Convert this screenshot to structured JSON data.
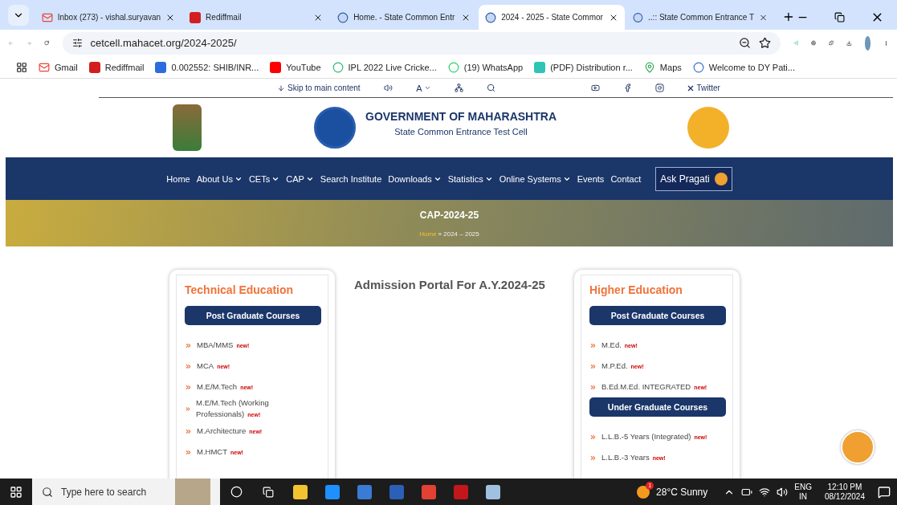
{
  "browser": {
    "tabs": [
      {
        "title": "Inbox (273) - vishal.suryavan",
        "selected": false
      },
      {
        "title": "Rediffmail",
        "selected": false
      },
      {
        "title": "Home. - State Common Entr",
        "selected": false
      },
      {
        "title": "2024 - 2025 - State Commor",
        "selected": true
      },
      {
        "title": "..:: State Common Entrance T",
        "selected": false
      }
    ],
    "url": "cetcell.mahacet.org/2024-2025/",
    "bookmarks": [
      {
        "label": "Gmail"
      },
      {
        "label": "Rediffmail"
      },
      {
        "label": "0.002552: SHIB/INR..."
      },
      {
        "label": "YouTube"
      },
      {
        "label": "IPL 2022 Live Cricke..."
      },
      {
        "label": "(19) WhatsApp"
      },
      {
        "label": "(PDF) Distribution r..."
      },
      {
        "label": "Maps"
      },
      {
        "label": "Welcome to DY Pati..."
      }
    ]
  },
  "site": {
    "utility": {
      "skip": "Skip to main content",
      "font_size": "A",
      "twitter": "Twitter"
    },
    "header": {
      "title": "GOVERNMENT OF MAHARASHTRA",
      "subtitle": "State Common Entrance Test Cell"
    },
    "nav": [
      {
        "label": "Home",
        "has_menu": false
      },
      {
        "label": "About Us",
        "has_menu": true
      },
      {
        "label": "CETs",
        "has_menu": true
      },
      {
        "label": "CAP",
        "has_menu": true
      },
      {
        "label": "Search Institute",
        "has_menu": false
      },
      {
        "label": "Downloads",
        "has_menu": true
      },
      {
        "label": "Statistics",
        "has_menu": true
      },
      {
        "label": "Online Systems",
        "has_menu": true
      },
      {
        "label": "Events",
        "has_menu": false
      },
      {
        "label": "Contact",
        "has_menu": false
      }
    ],
    "ask_button": "Ask Pragati",
    "banner": {
      "title": "CAP-2024-25",
      "breadcrumb_home": "Home",
      "breadcrumb_rest": "» 2024 – 2025"
    },
    "portal_heading": "Admission Portal For A.Y.2024-25",
    "cards": [
      {
        "title": "Technical Education",
        "sections": [
          {
            "heading": "Post Graduate Courses",
            "items": [
              {
                "label": "MBA/MMS",
                "badge": "new!"
              },
              {
                "label": "MCA",
                "badge": "new!"
              },
              {
                "label": "M.E/M.Tech",
                "badge": "new!"
              },
              {
                "label": "M.E/M.Tech (Working Professionals)",
                "badge": "new!"
              },
              {
                "label": "M.Architecture",
                "badge": "new!"
              },
              {
                "label": "M.HMCT",
                "badge": "new!"
              }
            ]
          }
        ]
      },
      {
        "title": "Higher Education",
        "sections": [
          {
            "heading": "Post Graduate Courses",
            "items": [
              {
                "label": "M.Ed.",
                "badge": "new!"
              },
              {
                "label": "M.P.Ed.",
                "badge": "new!"
              },
              {
                "label": "B.Ed.M.Ed. INTEGRATED",
                "badge": "new!"
              }
            ]
          },
          {
            "heading": "Under Graduate Courses",
            "items": [
              {
                "label": "L.L.B.-5 Years (Integrated)",
                "badge": "new!"
              },
              {
                "label": "L.L.B.-3 Years",
                "badge": "new!"
              }
            ]
          }
        ]
      }
    ]
  },
  "taskbar": {
    "search_placeholder": "Type here to search",
    "weather_badge": "1",
    "weather": "28°C Sunny",
    "language": "ENG",
    "region": "IN",
    "time": "12:10 PM",
    "date": "08/12/2024"
  }
}
